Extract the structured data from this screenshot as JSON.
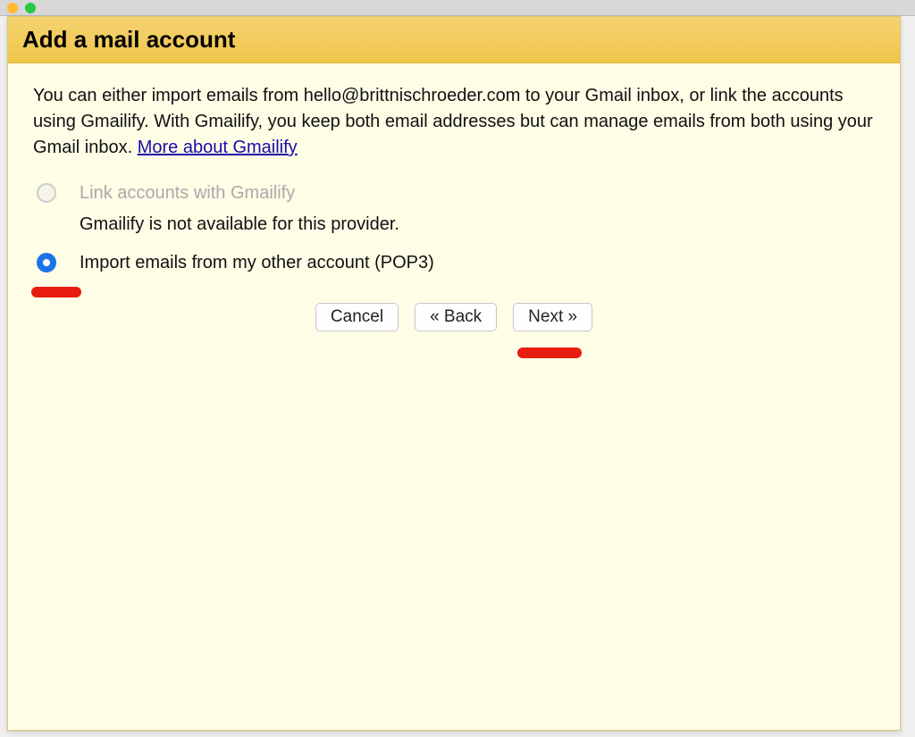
{
  "dialog": {
    "title": "Add a mail account",
    "intro_prefix": "You can either import emails from ",
    "email": "hello@brittnischroeder.com",
    "intro_mid": " to your Gmail inbox, or link the accounts using Gmailify. With Gmailify, you keep both email addresses but can manage emails from both using your Gmail inbox. ",
    "link_text": "More about Gmailify",
    "radio_gmailify_label": "Link accounts with Gmailify",
    "radio_gmailify_subtext": "Gmailify is not available for this provider.",
    "radio_pop3_label": "Import emails from my other account (POP3)",
    "buttons": {
      "cancel": "Cancel",
      "back": "« Back",
      "next": "Next »"
    }
  }
}
